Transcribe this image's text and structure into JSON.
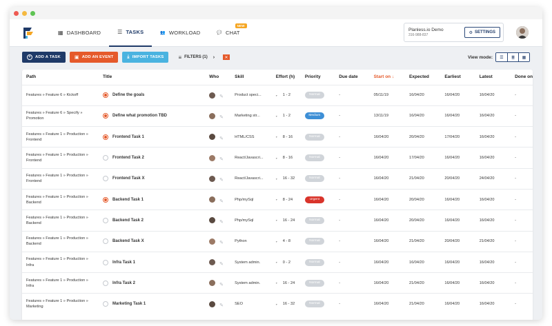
{
  "app": {
    "nav": [
      {
        "label": "DASHBOARD",
        "icon": "grid-icon",
        "active": false
      },
      {
        "label": "TASKS",
        "icon": "tasks-list-icon",
        "active": true
      },
      {
        "label": "WORKLOAD",
        "icon": "people-icon",
        "active": false
      },
      {
        "label": "CHAT",
        "icon": "chat-icon",
        "active": false,
        "badge": "NEW"
      }
    ],
    "account": {
      "name": "Planless.io Demo",
      "phone": "316-988-837"
    },
    "settings_label": "SETTINGS"
  },
  "toolbar": {
    "add_task": "ADD A TASK",
    "add_event": "ADD AN EVENT",
    "import_tasks": "IMPORT TASKS",
    "filters": "FILTERS (1)",
    "view_mode": "View mode:"
  },
  "colors": {
    "navy": "#1f3a68",
    "orange": "#e55a2b",
    "light_blue": "#4ab3e0",
    "medium": "#3d8fd6",
    "urgent": "#d9342b",
    "normal": "#d0d4d9"
  },
  "table": {
    "columns": [
      "Path",
      "Title",
      "Who",
      "Skill",
      "Effort (h)",
      "Priority",
      "Due date",
      "Start on",
      "Expected",
      "Earliest",
      "Latest",
      "Done on"
    ],
    "rows": [
      {
        "path": "Features » Feature 6 » Kickoff",
        "title": "Define the goals",
        "started": true,
        "skill": "Product speci...",
        "effort": "1 - 2",
        "priority": "Normal",
        "due": "-",
        "start": "05/11/19",
        "expected": "16/04/20",
        "earliest": "16/04/20",
        "latest": "16/04/20",
        "done": "-"
      },
      {
        "path": "Features » Feature 6 » Specify » Promotion",
        "title": "Define what promotion TBD",
        "started": true,
        "skill": "Marketing str...",
        "effort": "1 - 2",
        "priority": "Medium",
        "due": "-",
        "start": "13/11/19",
        "expected": "16/04/20",
        "earliest": "16/04/20",
        "latest": "16/04/20",
        "done": "-"
      },
      {
        "path": "Features » Feature 1 » Production » Frontend",
        "title": "Frontend Task 1",
        "started": true,
        "skill": "HTML/CSS",
        "effort": "8 - 16",
        "priority": "Normal",
        "due": "-",
        "start": "16/04/20",
        "expected": "20/04/20",
        "earliest": "17/04/20",
        "latest": "16/04/20",
        "done": "-"
      },
      {
        "path": "Features » Feature 1 » Production » Frontend",
        "title": "Frontend Task 2",
        "started": false,
        "skill": "React/Javascri...",
        "effort": "8 - 16",
        "priority": "Normal",
        "due": "-",
        "start": "16/04/20",
        "expected": "17/04/20",
        "earliest": "16/04/20",
        "latest": "16/04/20",
        "done": "-"
      },
      {
        "path": "Features » Feature 1 » Production » Frontend",
        "title": "Frontend Task X",
        "started": false,
        "skill": "React/Javascri...",
        "effort": "16 - 32",
        "priority": "Normal",
        "due": "-",
        "start": "16/04/20",
        "expected": "21/04/20",
        "earliest": "20/04/20",
        "latest": "24/04/20",
        "done": "-"
      },
      {
        "path": "Features » Feature 1 » Production » Backend",
        "title": "Backend Task 1",
        "started": true,
        "skill": "Php/mySql",
        "effort": "8 - 24",
        "priority": "Urgent",
        "due": "-",
        "start": "16/04/20",
        "expected": "20/04/20",
        "earliest": "16/04/20",
        "latest": "16/04/20",
        "done": "-"
      },
      {
        "path": "Features » Feature 1 » Production » Backend",
        "title": "Backend Task 2",
        "started": false,
        "skill": "Php/mySql",
        "effort": "16 - 24",
        "priority": "Normal",
        "due": "-",
        "start": "16/04/20",
        "expected": "20/04/20",
        "earliest": "16/04/20",
        "latest": "16/04/20",
        "done": "-"
      },
      {
        "path": "Features » Feature 1 » Production » Backend",
        "title": "Backend Task X",
        "started": false,
        "skill": "Python",
        "effort": "4 - 8",
        "priority": "Normal",
        "due": "-",
        "start": "16/04/20",
        "expected": "21/04/20",
        "earliest": "20/04/20",
        "latest": "21/04/20",
        "done": "-"
      },
      {
        "path": "Features » Feature 1 » Production » Infra",
        "title": "Infra Task 1",
        "started": false,
        "skill": "System admin.",
        "effort": "0 - 2",
        "priority": "Normal",
        "due": "-",
        "start": "16/04/20",
        "expected": "16/04/20",
        "earliest": "16/04/20",
        "latest": "16/04/20",
        "done": "-"
      },
      {
        "path": "Features » Feature 1 » Production » Infra",
        "title": "Infra Task 2",
        "started": false,
        "skill": "System admin.",
        "effort": "16 - 24",
        "priority": "Normal",
        "due": "-",
        "start": "16/04/20",
        "expected": "21/04/20",
        "earliest": "16/04/20",
        "latest": "16/04/20",
        "done": "-"
      },
      {
        "path": "Features » Feature 1 » Production » Marketing",
        "title": "Marketing Task 1",
        "started": false,
        "skill": "SEO",
        "effort": "16 - 32",
        "priority": "Normal",
        "due": "-",
        "start": "16/04/20",
        "expected": "21/04/20",
        "earliest": "16/04/20",
        "latest": "16/04/20",
        "done": "-"
      }
    ]
  }
}
